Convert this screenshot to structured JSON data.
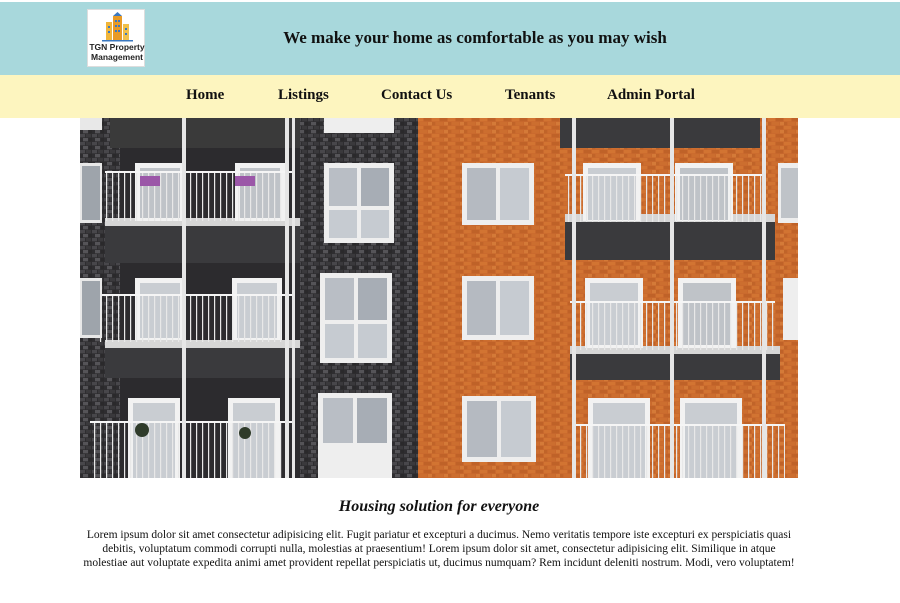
{
  "header": {
    "logo_text": "TGN Property Management",
    "tagline": "We make your home as comfortable as you may wish"
  },
  "nav": {
    "items": [
      {
        "label": "Home"
      },
      {
        "label": "Listings"
      },
      {
        "label": "Contact Us"
      },
      {
        "label": "Tenants"
      },
      {
        "label": "Admin Portal"
      }
    ]
  },
  "hero": {
    "icon": "apartment-building-photo"
  },
  "content": {
    "heading": "Housing solution for everyone",
    "paragraph": "Lorem ipsum dolor sit amet consectetur adipisicing elit. Fugit pariatur et excepturi a ducimus. Nemo veritatis tempore iste excepturi ex perspiciatis quasi debitis, voluptatum commodi corrupti nulla, molestias at praesentium! Lorem ipsum dolor sit amet, consectetur adipisicing elit. Similique in atque molestiae aut voluptate expedita animi amet provident repellat perspiciatis ut, ducimus numquam? Rem incidunt deleniti nostrum. Modi, vero voluptatem!"
  },
  "colors": {
    "header_bg": "#a8d8dc",
    "nav_bg": "#fdf5bf",
    "brick": "#c8692e",
    "dark_brick": "#3b3a3c"
  }
}
